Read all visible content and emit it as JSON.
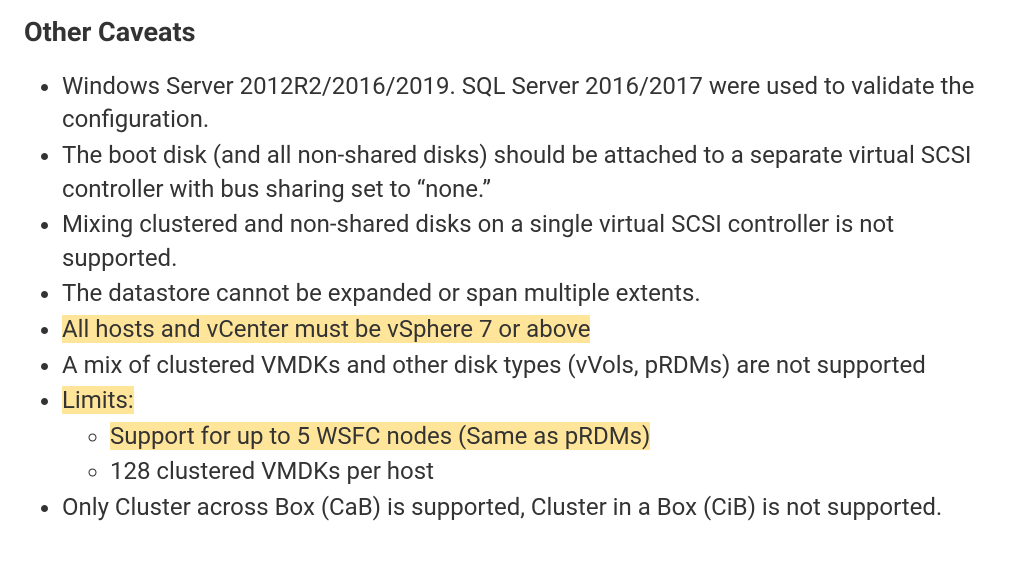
{
  "heading": "Other Caveats",
  "items": {
    "i1": "Windows Server 2012R2/2016/2019. SQL Server 2016/2017 were used to validate the configuration.",
    "i2": "The boot disk (and all non-shared disks) should be attached to a separate virtual SCSI controller with bus sharing set to “none.”",
    "i3": "Mixing clustered and non-shared disks on a single virtual SCSI controller is not supported.",
    "i4": "The datastore cannot be expanded or span multiple extents.",
    "i5": "All hosts and vCenter must be vSphere 7 or above",
    "i6": "A mix of clustered VMDKs and other disk types (vVols, pRDMs) are not supported",
    "i7": "Limits:",
    "i7a": "Support for up to 5 WSFC nodes (Same as pRDMs)",
    "i7b": "128 clustered VMDKs per host",
    "i8": "Only Cluster across Box (CaB) is supported, Cluster in a Box (CiB) is not supported."
  }
}
